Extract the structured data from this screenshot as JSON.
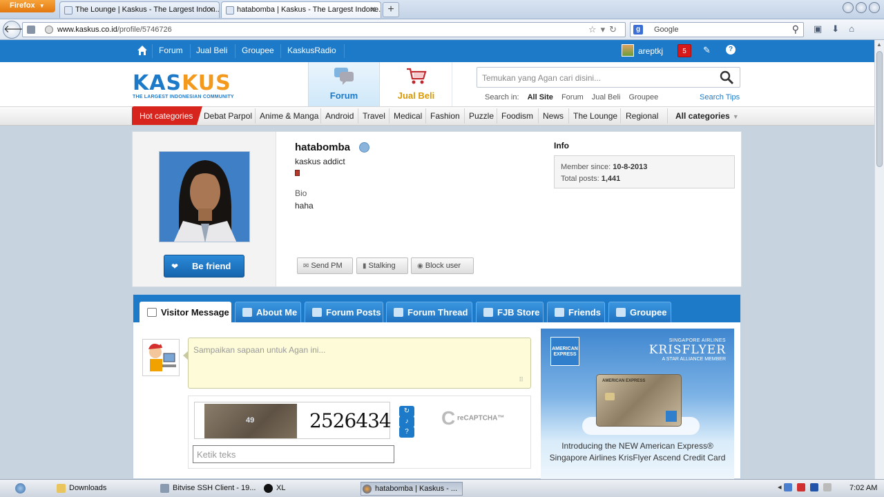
{
  "browser": {
    "app_button": "Firefox",
    "tabs": [
      {
        "label": "The Lounge | Kaskus - The Largest Indon..."
      },
      {
        "label": "hatabomba | Kaskus - The Largest Indone..."
      }
    ],
    "url_host": "www.kaskus.co.id",
    "url_path": "/profile/5746726",
    "search_engine_label": "Google"
  },
  "topbar": {
    "links": [
      "Forum",
      "Jual Beli",
      "Groupee",
      "KaskusRadio"
    ],
    "username": "areptkj",
    "notification_count": "5"
  },
  "header": {
    "logo_text": "KASKUS",
    "logo_tagline": "THE LARGEST INDONESIAN COMMUNITY",
    "tab_forum": "Forum",
    "tab_jualbeli": "Jual Beli",
    "search_placeholder": "Temukan yang Agan cari disini...",
    "search_in_label": "Search in:",
    "search_in_options": [
      "All Site",
      "Forum",
      "Jual Beli",
      "Groupee"
    ],
    "search_tips": "Search Tips"
  },
  "categories": {
    "hot_label": "Hot categories",
    "items": [
      "Debat Parpol",
      "Anime & Manga",
      "Android",
      "Travel",
      "Medical",
      "Fashion",
      "Puzzle",
      "Foodism",
      "News",
      "The Lounge",
      "Regional"
    ],
    "all_label": "All categories"
  },
  "profile": {
    "username": "hatabomba",
    "rank": "kaskus addict",
    "bio_label": "Bio",
    "bio_value": "haha",
    "befriend_label": "Be friend",
    "actions": [
      "Send PM",
      "Stalking",
      "Block user"
    ],
    "info_title": "Info",
    "member_since_label": "Member since:",
    "member_since_value": "10-8-2013",
    "total_posts_label": "Total posts:",
    "total_posts_value": "1,441"
  },
  "profile_tabs": [
    "Visitor Message",
    "About Me",
    "Forum Posts",
    "Forum Thread",
    "FJB Store",
    "Friends",
    "Groupee"
  ],
  "visitor_message": {
    "placeholder": "Sampaikan sapaan untuk Agan ini...",
    "captcha_text": "2526434",
    "captcha_photo_text": "49",
    "captcha_input_placeholder": "Ketik teks",
    "recaptcha_label": "reCAPTCHA™"
  },
  "ad": {
    "amex_label": "AMERICAN EXPRESS",
    "airline_line1": "SINGAPORE AIRLINES",
    "airline_line2": "KRISFLYER",
    "airline_line3": "A STAR ALLIANCE MEMBER",
    "card_label": "AMERICAN EXPRESS",
    "text_line1": "Introducing the NEW American Express®",
    "text_line2": "Singapore Airlines KrisFlyer Ascend Credit Card"
  },
  "taskbar": {
    "items": [
      "Downloads",
      "Bitvise SSH Client - 19...",
      "XL",
      "hatabomba | Kaskus - ..."
    ],
    "clock": "7:02 AM"
  }
}
